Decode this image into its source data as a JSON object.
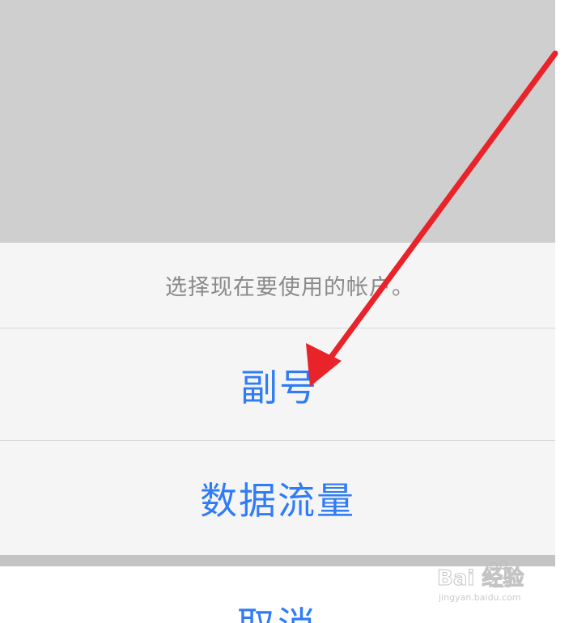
{
  "action_sheet": {
    "message": "选择现在要使用的帐户。",
    "options": [
      {
        "label": "副号"
      },
      {
        "label": "数据流量"
      }
    ],
    "cancel_label": "取消"
  },
  "annotation": {
    "arrow_color": "#e8232a"
  },
  "watermark": {
    "brand": "Bai  经验",
    "url": "jingyan.baidu.com"
  },
  "colors": {
    "accent": "#2f7cf6",
    "message_text": "#8a8a8a",
    "sheet_bg": "#f5f5f5",
    "backdrop": "#cfcfcf"
  }
}
